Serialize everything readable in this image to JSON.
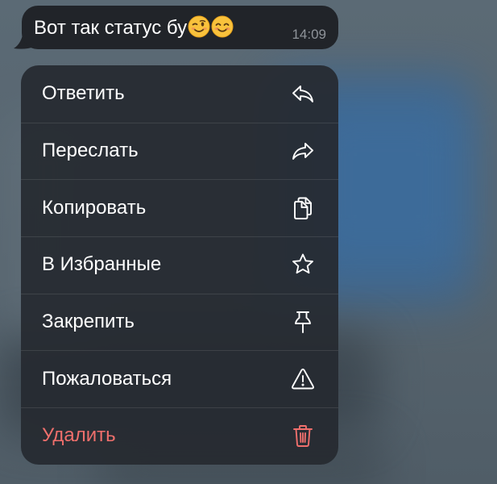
{
  "message": {
    "text": "Вот так статус бу",
    "emojis": [
      "winking-face",
      "smiling-face-with-smiling-eyes"
    ],
    "time": "14:09"
  },
  "context_menu": {
    "items": [
      {
        "label": "Ответить",
        "icon": "reply-icon"
      },
      {
        "label": "Переслать",
        "icon": "forward-icon"
      },
      {
        "label": "Копировать",
        "icon": "copy-icon"
      },
      {
        "label": "В Избранные",
        "icon": "star-icon"
      },
      {
        "label": "Закрепить",
        "icon": "pin-icon"
      },
      {
        "label": "Пожаловаться",
        "icon": "warning-icon"
      },
      {
        "label": "Удалить",
        "icon": "trash-icon"
      }
    ]
  },
  "colors": {
    "menu_background": "#262a30",
    "bubble_background": "#212429",
    "text": "#ffffff",
    "danger": "#ef6f6c",
    "timestamp": "#8e9399"
  }
}
